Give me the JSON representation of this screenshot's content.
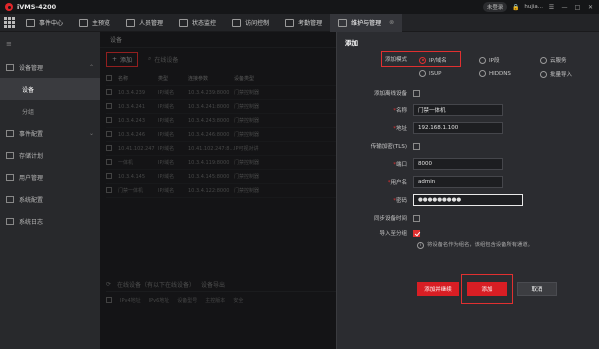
{
  "titlebar": {
    "app_name": "iVMS-4200",
    "license": "未登录",
    "user": "hujia...",
    "icons": [
      "lock-icon",
      "menu-icon",
      "minimize-icon",
      "maximize-icon",
      "close-icon"
    ]
  },
  "tabs": [
    {
      "label": "事件中心",
      "icon": "event-icon"
    },
    {
      "label": "主预览",
      "icon": "preview-icon"
    },
    {
      "label": "人员管理",
      "icon": "person-icon"
    },
    {
      "label": "状态监控",
      "icon": "monitor-icon"
    },
    {
      "label": "访问控制",
      "icon": "access-icon"
    },
    {
      "label": "考勤管理",
      "icon": "attendance-icon"
    },
    {
      "label": "维护与管理",
      "icon": "maintenance-icon",
      "active": true
    }
  ],
  "sidebar": {
    "groups": [
      {
        "label": "设备管理",
        "expanded": true,
        "children": [
          {
            "label": "设备",
            "active": true
          },
          {
            "label": "分组"
          }
        ]
      },
      {
        "label": "事件配置"
      },
      {
        "label": "存储计划"
      },
      {
        "label": "用户管理"
      },
      {
        "label": "系统配置"
      },
      {
        "label": "系统日志"
      }
    ]
  },
  "main": {
    "header": "设备",
    "toolbar": {
      "add_label": "添加",
      "online_label": "在线设备"
    },
    "table": {
      "headers": [
        "名称",
        "类型",
        "连接参数",
        "设备类型"
      ],
      "rows": [
        [
          "10.3.4.239",
          "IP/域名",
          "10.3.4.239:8000",
          "门禁控制器"
        ],
        [
          "10.3.4.241",
          "IP/域名",
          "10.3.4.241:8000",
          "门禁控制器"
        ],
        [
          "10.3.4.243",
          "IP/域名",
          "10.3.4.243:8000",
          "门禁控制器"
        ],
        [
          "10.3.4.246",
          "IP/域名",
          "10.3.4.246:8000",
          "门禁控制器"
        ],
        [
          "10.41.102.247",
          "IP/域名",
          "10.41.102.247:8...",
          "IP可视对讲"
        ],
        [
          "一体机",
          "IP/域名",
          "10.3.4.119:8000",
          "门禁控制器"
        ],
        [
          "10.3.4.145",
          "IP/域名",
          "10.3.4.145:8000",
          "门禁控制器"
        ],
        [
          "门禁一体机",
          "IP/域名",
          "10.3.4.122:8000",
          "门禁控制器"
        ]
      ]
    },
    "bottom": {
      "title": "在线设备（有以下在线设备）",
      "export": "设备导出",
      "headers": [
        "IPv4地址",
        "IPv6地址",
        "设备型号",
        "主控版本",
        "安全"
      ]
    }
  },
  "dialog": {
    "title": "添加",
    "mode_label": "添加模式",
    "modes": [
      {
        "label": "IP/域名",
        "selected": true
      },
      {
        "label": "IP段"
      },
      {
        "label": "云服务"
      },
      {
        "label": "ISUP"
      },
      {
        "label": "HIDDNS"
      },
      {
        "label": "批量导入"
      }
    ],
    "offline_label": "添加离线设备",
    "name_label": "名称",
    "name_value": "门禁一体机",
    "address_label": "地址",
    "address_value": "192.168.1.100",
    "tls_label": "传输加密(TLS)",
    "port_label": "端口",
    "port_value": "8000",
    "user_label": "用户名",
    "user_value": "admin",
    "password_label": "密码",
    "password_value": "●●●●●●●●●",
    "sync_label": "同步设备时间",
    "import_group_label": "导入至分组",
    "hint": "将设备名作为组名，该组包含设备所有通道。",
    "add_continue": "添加并继续",
    "add": "添加",
    "cancel": "取消"
  },
  "colors": {
    "accent": "#d81e24",
    "bg": "#1e1f22",
    "dialog_bg": "#2b2c30"
  }
}
